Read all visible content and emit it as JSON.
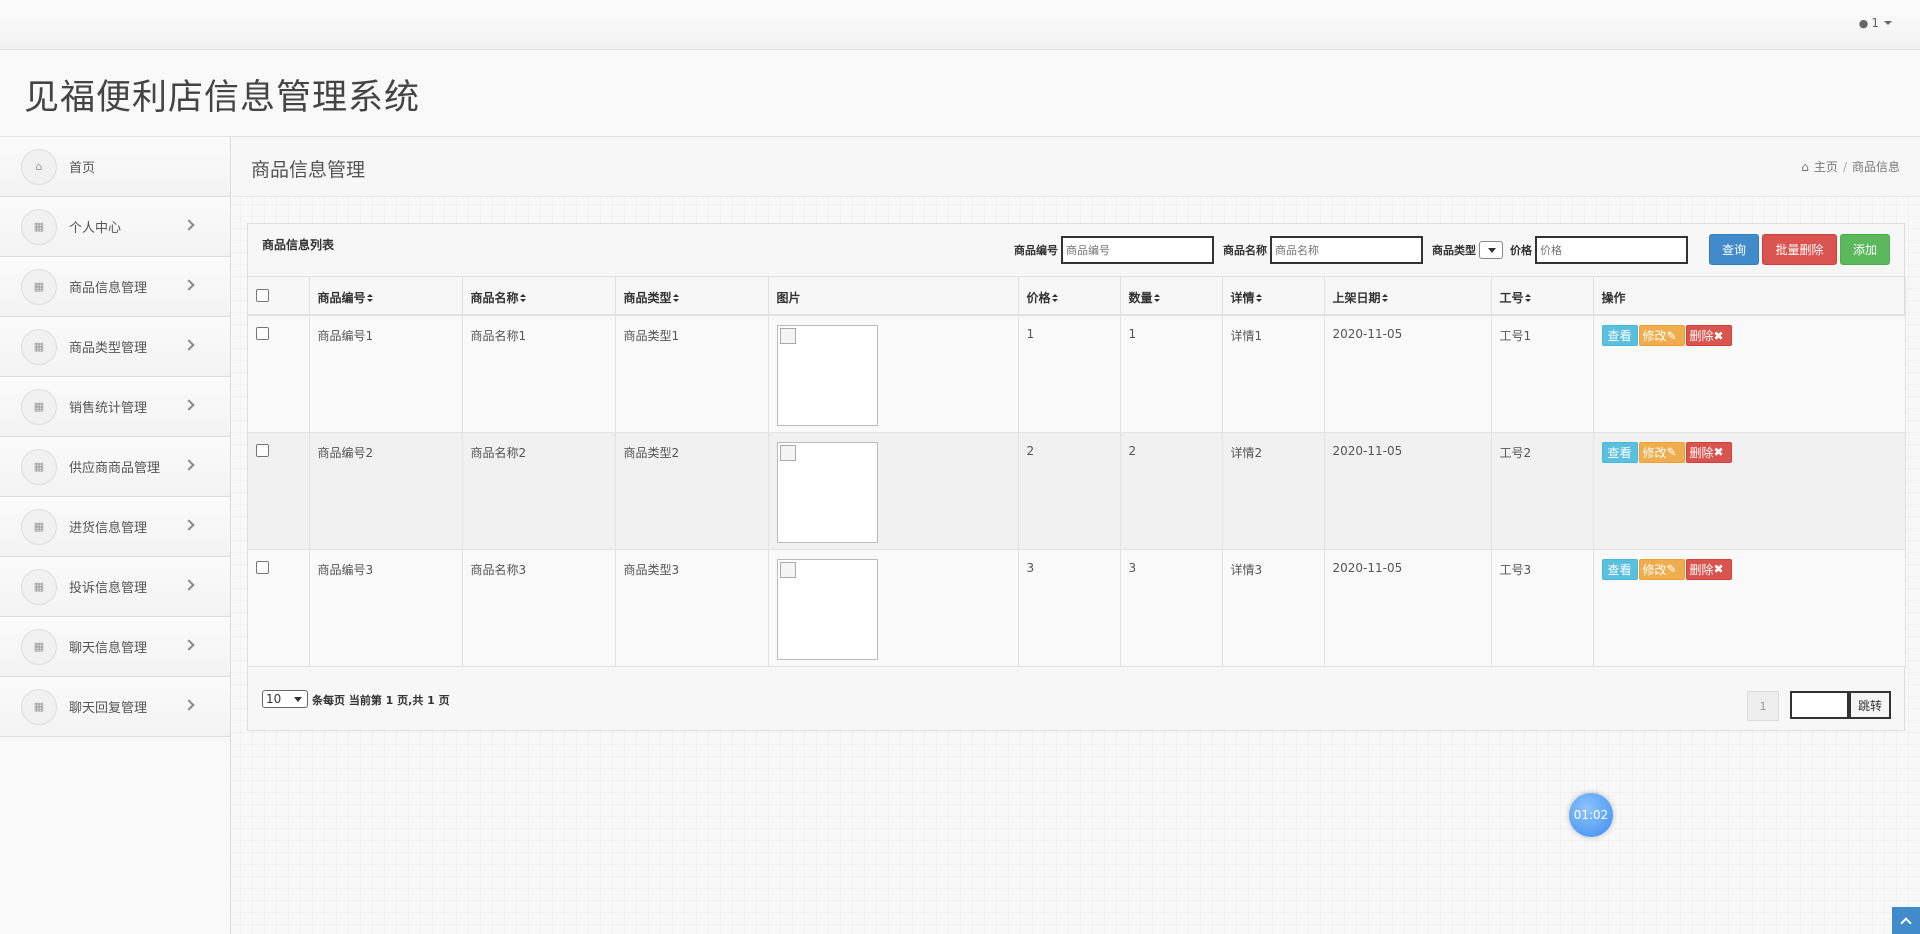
{
  "topbar": {
    "user_label": "1"
  },
  "brand": {
    "title": "见福便利店信息管理系统"
  },
  "sidebar": {
    "items": [
      {
        "label": "首页",
        "icon": "home-icon",
        "has_arrow": false
      },
      {
        "label": "个人中心",
        "icon": "grid-icon",
        "has_arrow": true
      },
      {
        "label": "商品信息管理",
        "icon": "grid-icon",
        "has_arrow": true
      },
      {
        "label": "商品类型管理",
        "icon": "grid-icon",
        "has_arrow": true
      },
      {
        "label": "销售统计管理",
        "icon": "grid-icon",
        "has_arrow": true
      },
      {
        "label": "供应商商品管理",
        "icon": "grid-icon",
        "has_arrow": true
      },
      {
        "label": "进货信息管理",
        "icon": "grid-icon",
        "has_arrow": true
      },
      {
        "label": "投诉信息管理",
        "icon": "grid-icon",
        "has_arrow": true
      },
      {
        "label": "聊天信息管理",
        "icon": "grid-icon",
        "has_arrow": true
      },
      {
        "label": "聊天回复管理",
        "icon": "grid-icon",
        "has_arrow": true
      }
    ]
  },
  "page": {
    "title": "商品信息管理",
    "breadcrumb": {
      "home": "主页",
      "current": "商品信息"
    }
  },
  "panel": {
    "title": "商品信息列表",
    "filters": {
      "code_label": "商品编号",
      "code_placeholder": "商品编号",
      "name_label": "商品名称",
      "name_placeholder": "商品名称",
      "type_label": "商品类型",
      "price_label": "价格",
      "price_placeholder": "价格"
    },
    "buttons": {
      "search": "查询",
      "batch_delete": "批量删除",
      "add": "添加"
    }
  },
  "table": {
    "columns": [
      "商品编号",
      "商品名称",
      "商品类型",
      "图片",
      "价格",
      "数量",
      "详情",
      "上架日期",
      "工号",
      "操作"
    ],
    "rows": [
      {
        "code": "商品编号1",
        "name": "商品名称1",
        "type": "商品类型1",
        "price": "1",
        "qty": "1",
        "detail": "详情1",
        "date": "2020-11-05",
        "staff": "工号1"
      },
      {
        "code": "商品编号2",
        "name": "商品名称2",
        "type": "商品类型2",
        "price": "2",
        "qty": "2",
        "detail": "详情2",
        "date": "2020-11-05",
        "staff": "工号2"
      },
      {
        "code": "商品编号3",
        "name": "商品名称3",
        "type": "商品类型3",
        "price": "3",
        "qty": "3",
        "detail": "详情3",
        "date": "2020-11-05",
        "staff": "工号3"
      }
    ],
    "actions": {
      "view": "查看",
      "edit": "修改",
      "delete": "删除"
    }
  },
  "pagination": {
    "page_size": "10",
    "info": "条每页 当前第 1 页,共 1 页",
    "current_page": "1",
    "jump": "跳转"
  },
  "timer": {
    "value": "01:02"
  },
  "colors": {
    "primary": "#428bca",
    "danger": "#d9534f",
    "success": "#5cb85c",
    "info": "#5bc0de",
    "warning": "#f0ad4e"
  }
}
